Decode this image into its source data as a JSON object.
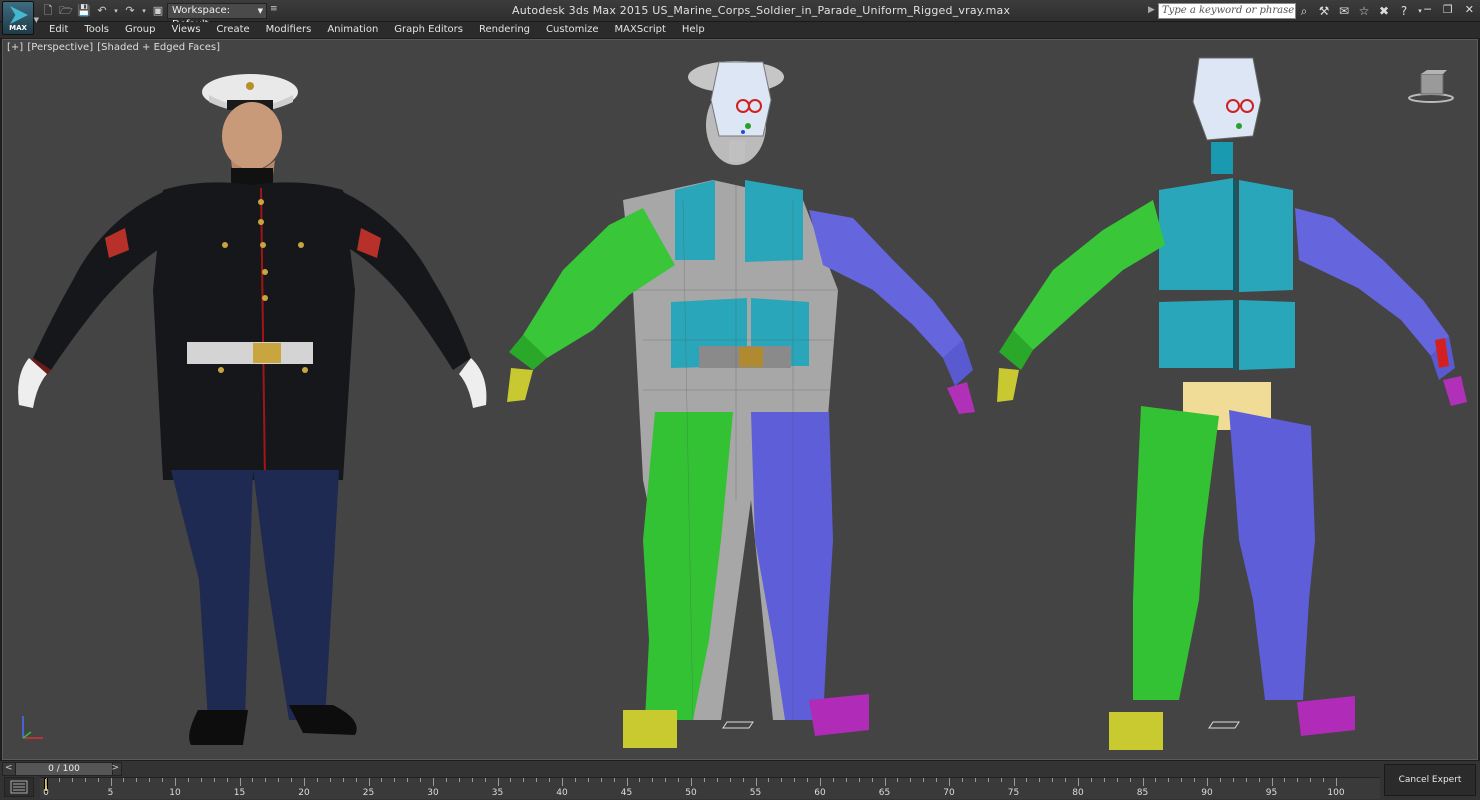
{
  "app": {
    "title": "Autodesk 3ds Max  2015    US_Marine_Corps_Soldier_in_Parade_Uniform_Rigged_vray.max",
    "logo_text": "MAX",
    "workspace_label": "Workspace: Default",
    "search_placeholder": "Type a keyword or phrase"
  },
  "menu": [
    "Edit",
    "Tools",
    "Group",
    "Views",
    "Create",
    "Modifiers",
    "Animation",
    "Graph Editors",
    "Rendering",
    "Customize",
    "MAXScript",
    "Help"
  ],
  "viewport": {
    "label_plus": "[+]",
    "label_view": "[Perspective]",
    "label_shading": "[Shaded + Edged Faces]"
  },
  "timeline": {
    "slider_text": "0 / 100",
    "slider_left": "<",
    "slider_right": ">",
    "ticks": [
      "0",
      "5",
      "10",
      "15",
      "20",
      "25",
      "30",
      "35",
      "40",
      "45",
      "50",
      "55",
      "60",
      "65",
      "70",
      "75",
      "80",
      "85",
      "90",
      "95",
      "100"
    ],
    "cancel_expert": "Cancel Expert Mode"
  },
  "colors": {
    "viewport_bg": "#444444",
    "bone_green": "#2fbf2f",
    "bone_blue": "#5a5ad6",
    "bone_cyan": "#1f9fb5",
    "bone_magenta": "#b02cb8",
    "bone_yellow": "#c8c830"
  },
  "icons": [
    "new-icon",
    "open-icon",
    "save-icon",
    "undo-icon",
    "redo-icon",
    "project-icon",
    "binoculars-icon",
    "star-icon",
    "help-icon",
    "minimize-icon",
    "maximize-icon",
    "close-icon"
  ]
}
